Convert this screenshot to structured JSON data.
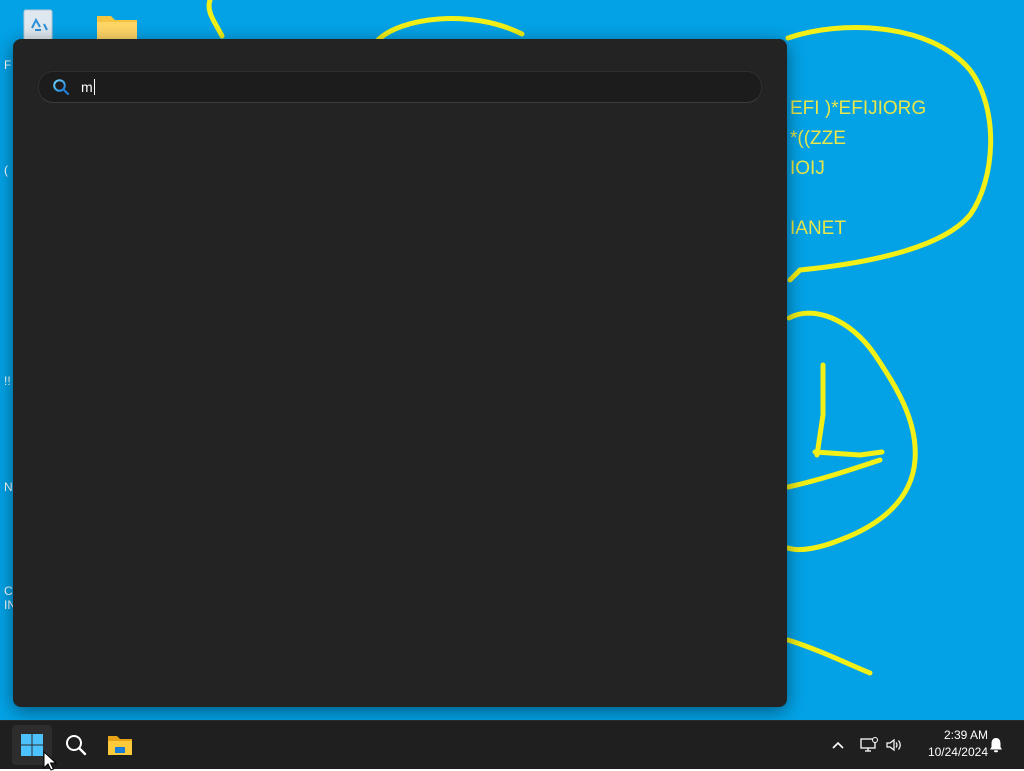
{
  "wallpaper": {
    "color": "#03a2e6",
    "doodle_color": "#f2f016",
    "doodle_text_lines": [
      "EFI )*EFIJIORG",
      "*((ZZE",
      "IOIJ",
      "IANET"
    ]
  },
  "desktop": {
    "icons": [
      "recycle-bin-icon",
      "folder-icon"
    ],
    "edge_fragments": [
      "F",
      "(",
      "!!",
      "N",
      "C",
      "IN"
    ]
  },
  "search": {
    "query": "m",
    "icon": "search-icon",
    "panel_color": "#232323"
  },
  "taskbar": {
    "apps": [
      {
        "name": "start",
        "icon": "windows-logo-icon"
      },
      {
        "name": "search",
        "icon": "search-icon"
      },
      {
        "name": "file-explorer",
        "icon": "folder-icon"
      }
    ],
    "tray_icons": [
      "chevron-up-icon",
      "network-icon",
      "volume-icon",
      "bell-icon"
    ],
    "time": "2:39 AM",
    "date": "10/24/2024"
  }
}
